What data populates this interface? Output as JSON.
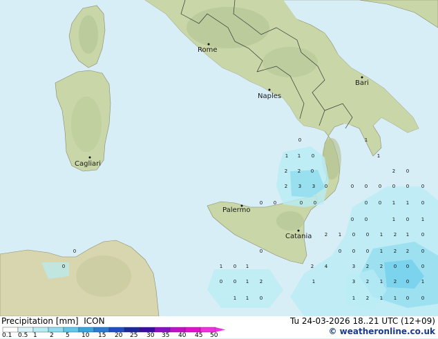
{
  "legend": {
    "title": "Precipitation [mm]",
    "model": "ICON",
    "ticks": [
      "0.1",
      "0.5",
      "1",
      "2",
      "5",
      "10",
      "15",
      "20",
      "25",
      "30",
      "35",
      "40",
      "45",
      "50"
    ],
    "colors": [
      "#ffffff",
      "#d6f4f7",
      "#b8ecf4",
      "#8fdcef",
      "#5ec8ea",
      "#35a6e0",
      "#2a7dd6",
      "#1f4fc2",
      "#1a2a9e",
      "#3a0ca0",
      "#8a10c0",
      "#c010c8",
      "#e010d0",
      "#f030e0"
    ]
  },
  "datetime": "Tu 24-03-2026 18..21 UTC (12+09)",
  "credit": "© weatheronline.co.uk",
  "cities": [
    {
      "name": "Rome"
    },
    {
      "name": "Bari"
    },
    {
      "name": "Naples"
    },
    {
      "name": "Cagliari"
    },
    {
      "name": "Palermo"
    },
    {
      "name": "Catania"
    }
  ],
  "values": [
    "0",
    "1",
    "1",
    "0",
    "2",
    "2",
    "0",
    "2",
    "3",
    "3",
    "0",
    "1",
    "1",
    "2",
    "0",
    "0",
    "0",
    "0",
    "0",
    "0",
    "0",
    "0",
    "0",
    "0",
    "0",
    "0",
    "0",
    "1",
    "1",
    "0",
    "0",
    "0",
    "1",
    "0",
    "1",
    "2",
    "1",
    "0",
    "0",
    "1",
    "2",
    "1",
    "0",
    "0",
    "0",
    "0",
    "0",
    "1",
    "2",
    "2",
    "0",
    "1",
    "0",
    "1",
    "2",
    "4",
    "3",
    "2",
    "2",
    "0",
    "0",
    "0",
    "0",
    "0",
    "1",
    "2",
    "1",
    "3",
    "2",
    "1",
    "2",
    "0",
    "1",
    "1",
    "1",
    "0",
    "1",
    "2",
    "1",
    "1",
    "0",
    "0",
    "0",
    "0"
  ]
}
